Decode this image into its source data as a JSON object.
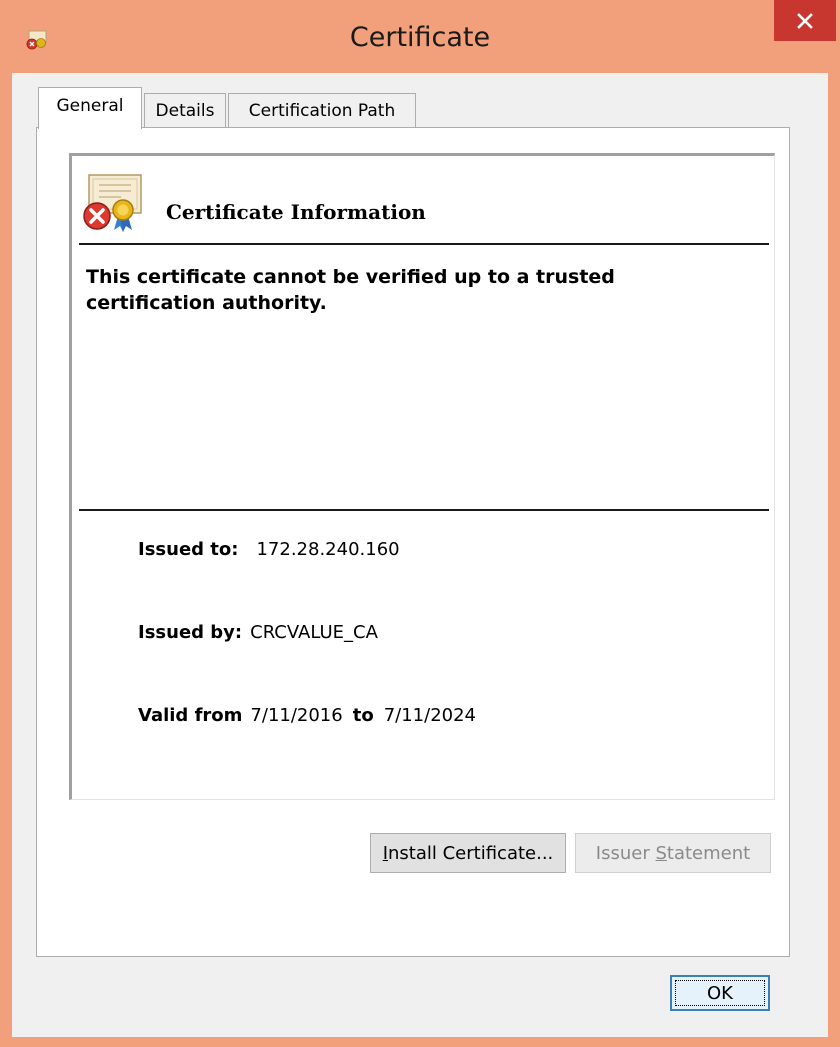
{
  "window": {
    "title": "Certificate",
    "title_icon": "certificate-error-icon",
    "close_icon": "close-icon",
    "frame_color": "#f2a07b",
    "close_color": "#c7372f"
  },
  "tabs": [
    {
      "label": "General",
      "active": true
    },
    {
      "label": "Details",
      "active": false
    },
    {
      "label": "Certification Path",
      "active": false
    }
  ],
  "info": {
    "icon": "certificate-error-icon",
    "heading": "Certificate Information",
    "warning": "This certificate cannot be verified up to a trusted certification authority.",
    "issued_to_label": "Issued to:",
    "issued_to_value": "172.28.240.160",
    "issued_by_label": "Issued by:",
    "issued_by_value": "CRCVALUE_CA",
    "valid_from_label": "Valid from",
    "valid_from_value": "7/11/2016",
    "valid_to_label": "to",
    "valid_to_value": "7/11/2024"
  },
  "buttons": {
    "install_pre": "I",
    "install_rest": "nstall Certificate...",
    "issuer_pre": "Issuer ",
    "issuer_acc": "S",
    "issuer_rest": "tatement",
    "ok": "OK"
  }
}
